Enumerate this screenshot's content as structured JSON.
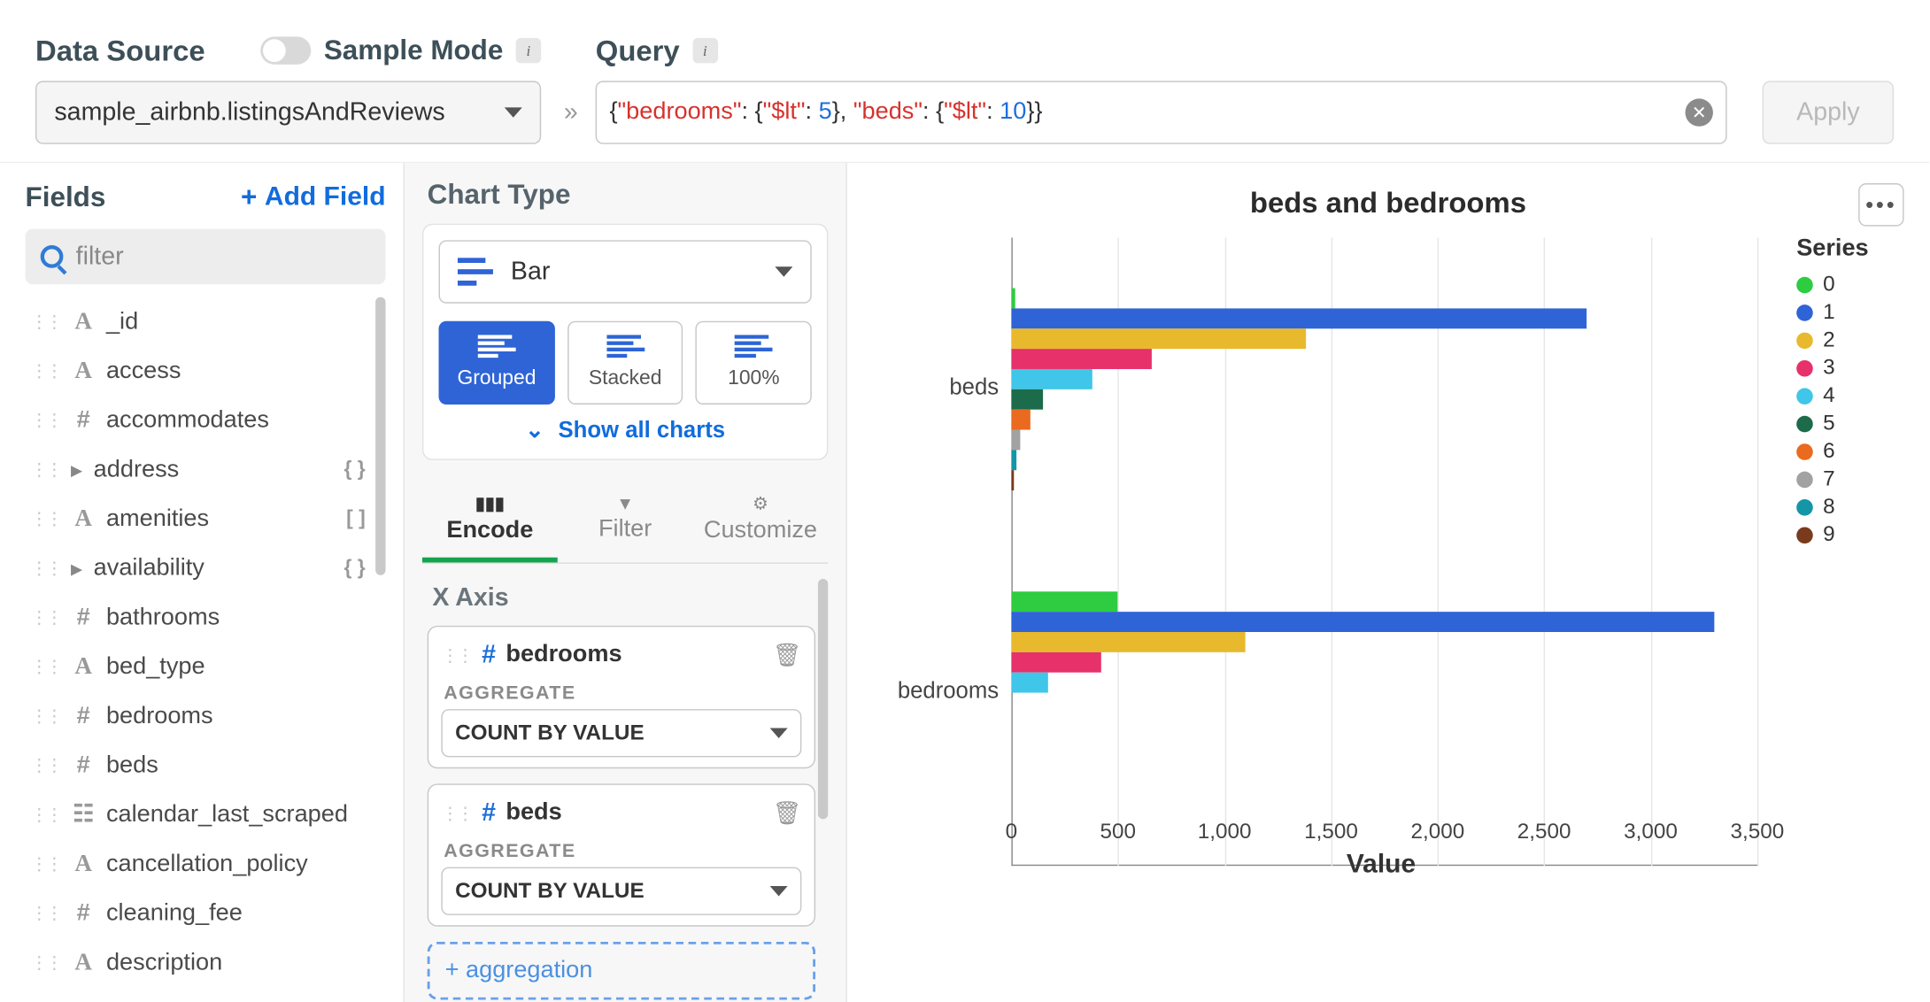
{
  "topbar": {
    "data_source_label": "Data Source",
    "sample_mode_label": "Sample Mode",
    "data_source_value": "sample_airbnb.listingsAndReviews",
    "query_label": "Query",
    "query_raw": "{\"bedrooms\": {\"$lt\": 5}, \"beds\": {\"$lt\": 10}}",
    "apply_label": "Apply"
  },
  "fields": {
    "title": "Fields",
    "add_label": "Add Field",
    "filter_placeholder": "filter",
    "items": [
      {
        "icon": "A",
        "name": "_id"
      },
      {
        "icon": "A",
        "name": "access"
      },
      {
        "icon": "#",
        "name": "accommodates"
      },
      {
        "icon": ">",
        "name": "address",
        "suffix": "{ }"
      },
      {
        "icon": "A",
        "name": "amenities",
        "suffix": "[ ]"
      },
      {
        "icon": ">",
        "name": "availability",
        "suffix": "{ }"
      },
      {
        "icon": "#",
        "name": "bathrooms"
      },
      {
        "icon": "A",
        "name": "bed_type"
      },
      {
        "icon": "#",
        "name": "bedrooms"
      },
      {
        "icon": "#",
        "name": "beds"
      },
      {
        "icon": "☷",
        "name": "calendar_last_scraped"
      },
      {
        "icon": "A",
        "name": "cancellation_policy"
      },
      {
        "icon": "#",
        "name": "cleaning_fee"
      },
      {
        "icon": "A",
        "name": "description"
      }
    ]
  },
  "config": {
    "chart_type_label": "Chart Type",
    "chart_type_value": "Bar",
    "subtypes": [
      "Grouped",
      "Stacked",
      "100%"
    ],
    "subtype_active": 0,
    "show_all_label": "Show all charts",
    "tabs": [
      "Encode",
      "Filter",
      "Customize"
    ],
    "tab_active": 0,
    "x_axis_label": "X Axis",
    "aggregate_label": "AGGREGATE",
    "aggregate_value": "COUNT BY VALUE",
    "pills": [
      {
        "name": "bedrooms"
      },
      {
        "name": "beds"
      }
    ],
    "add_agg_label": "+ aggregation"
  },
  "chart": {
    "title": "beds and bedrooms",
    "legend_title": "Series",
    "xlabel": "Value",
    "x_ticks": [
      0,
      500,
      1000,
      1500,
      2000,
      2500,
      3000,
      3500
    ],
    "x_max": 3500,
    "series": [
      {
        "key": "0",
        "color": "#2ecc40"
      },
      {
        "key": "1",
        "color": "#2e64d6"
      },
      {
        "key": "2",
        "color": "#e8b92c"
      },
      {
        "key": "3",
        "color": "#e6316a"
      },
      {
        "key": "4",
        "color": "#3fc6e8"
      },
      {
        "key": "5",
        "color": "#1c6b4a"
      },
      {
        "key": "6",
        "color": "#ea6a1f"
      },
      {
        "key": "7",
        "color": "#a2a2a2"
      },
      {
        "key": "8",
        "color": "#1596a6"
      },
      {
        "key": "9",
        "color": "#7a3a1e"
      }
    ]
  },
  "chart_data": {
    "type": "bar",
    "orientation": "horizontal",
    "stacked": false,
    "xlabel": "Value",
    "ylabel": "",
    "xlim": [
      0,
      3500
    ],
    "title": "beds and bedrooms",
    "categories": [
      "beds",
      "bedrooms"
    ],
    "series": [
      {
        "name": "0",
        "values": [
          20,
          500
        ]
      },
      {
        "name": "1",
        "values": [
          2700,
          3300
        ]
      },
      {
        "name": "2",
        "values": [
          1380,
          1100
        ]
      },
      {
        "name": "3",
        "values": [
          660,
          420
        ]
      },
      {
        "name": "4",
        "values": [
          380,
          170
        ]
      },
      {
        "name": "5",
        "values": [
          150,
          0
        ]
      },
      {
        "name": "6",
        "values": [
          90,
          0
        ]
      },
      {
        "name": "7",
        "values": [
          40,
          0
        ]
      },
      {
        "name": "8",
        "values": [
          25,
          0
        ]
      },
      {
        "name": "9",
        "values": [
          10,
          0
        ]
      }
    ]
  }
}
